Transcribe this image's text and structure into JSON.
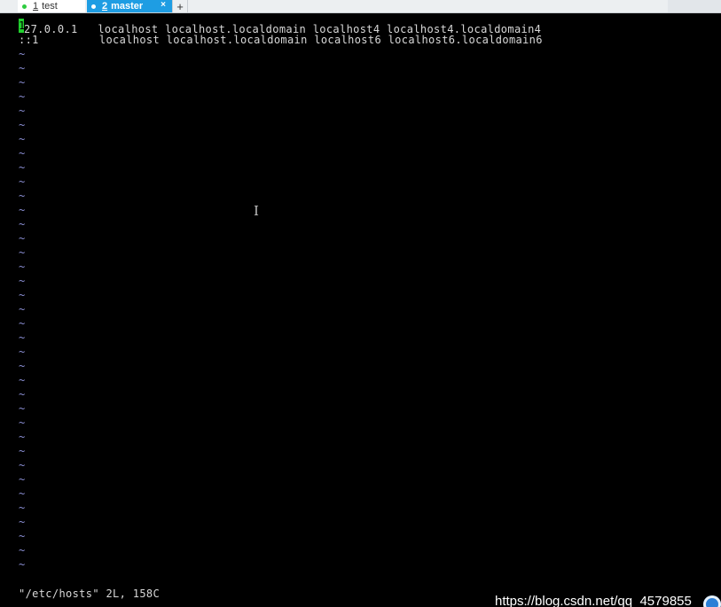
{
  "tabs": [
    {
      "number": "1",
      "name": "test"
    },
    {
      "number": "2",
      "name": "master",
      "close": "×"
    }
  ],
  "tab_add_label": "+",
  "editor": {
    "line1_cursor_char": "1",
    "line1_rest": "27.0.0.1   localhost localhost.localdomain localhost4 localhost4.localdomain4",
    "line2": "::1         localhost localhost.localdomain localhost6 localhost6.localdomain6",
    "tilde": "~",
    "status": "\"/etc/hosts\" 2L, 158C"
  },
  "pointer_glyph": "I",
  "watermark": "https://blog.csdn.net/qq_4579855",
  "colors": {
    "tab_active": "#1e9de3",
    "cursor": "#21d02e",
    "tilde": "#8a8fd4"
  }
}
